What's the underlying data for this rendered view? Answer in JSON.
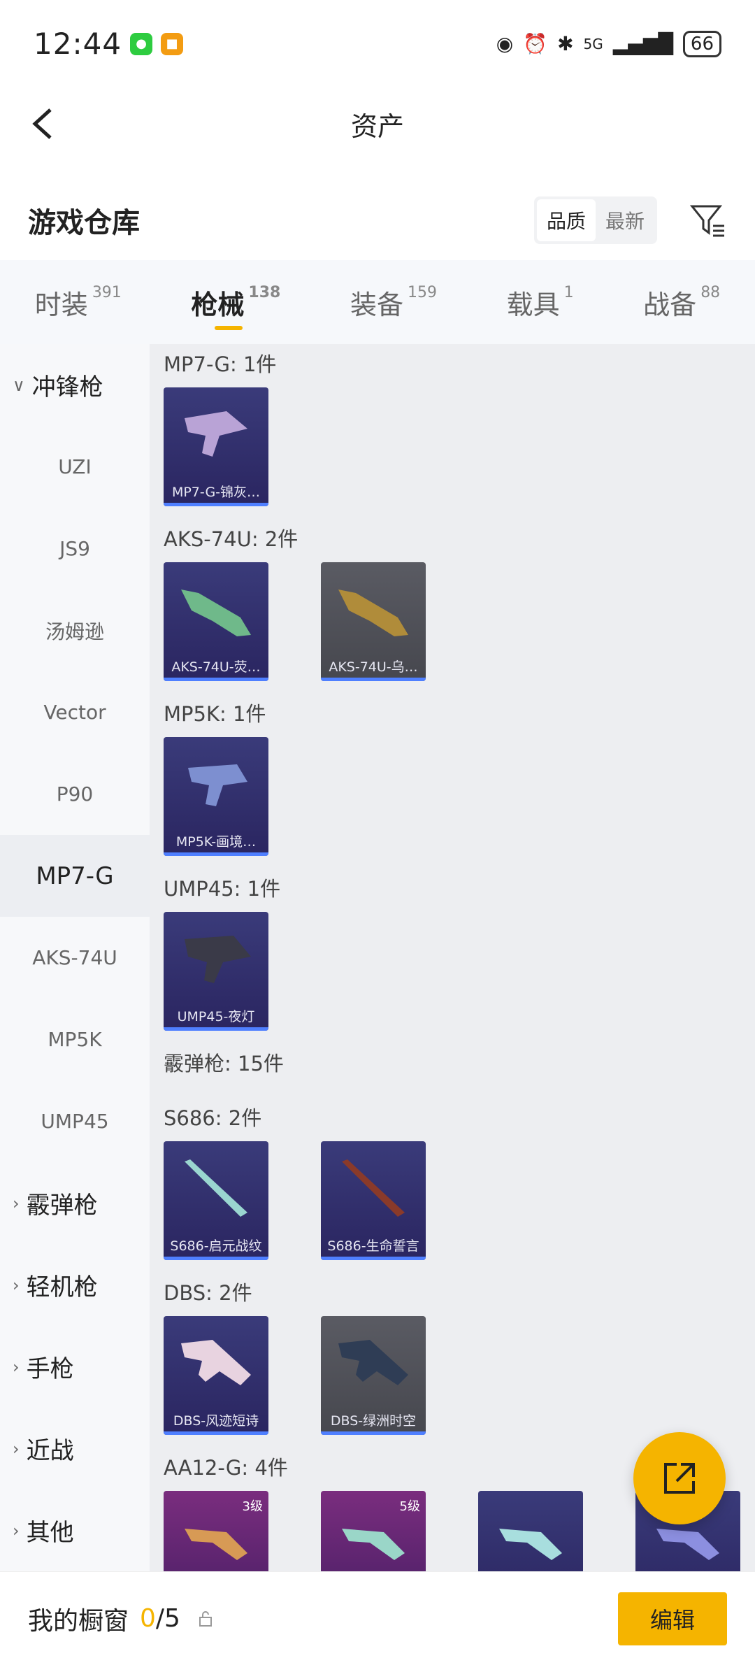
{
  "status": {
    "time": "12:44",
    "battery": "66",
    "network": "5G"
  },
  "header": {
    "title": "资产"
  },
  "warehouse": {
    "title": "游戏仓库",
    "sort_quality": "品质",
    "sort_latest": "最新"
  },
  "tabs": [
    {
      "label": "时装",
      "count": "391"
    },
    {
      "label": "枪械",
      "count": "138"
    },
    {
      "label": "装备",
      "count": "159"
    },
    {
      "label": "载具",
      "count": "1"
    },
    {
      "label": "战备",
      "count": "88"
    }
  ],
  "sidebar": {
    "category_smg": "冲锋枪",
    "subs": [
      "UZI",
      "JS9",
      "汤姆逊",
      "Vector",
      "P90",
      "MP7-G",
      "AKS-74U",
      "MP5K",
      "UMP45"
    ],
    "category_shotgun": "霰弹枪",
    "category_lmg": "轻机枪",
    "category_pistol": "手枪",
    "category_melee": "近战",
    "category_other": "其他"
  },
  "groups": {
    "mp7": {
      "title": "MP7-G: 1件",
      "items": [
        "MP7-G-锦灰…"
      ]
    },
    "aks": {
      "title": "AKS-74U: 2件",
      "items": [
        "AKS-74U-荧…",
        "AKS-74U-乌…"
      ]
    },
    "mp5k": {
      "title": "MP5K: 1件",
      "items": [
        "MP5K-画境…"
      ]
    },
    "ump": {
      "title": "UMP45: 1件",
      "items": [
        "UMP45-夜灯"
      ]
    },
    "shotgun": {
      "title": "霰弹枪: 15件"
    },
    "s686": {
      "title": "S686: 2件",
      "items": [
        "S686-启元战纹",
        "S686-生命誓言"
      ]
    },
    "dbs": {
      "title": "DBS: 2件",
      "items": [
        "DBS-风迹短诗",
        "DBS-绿洲时空"
      ]
    },
    "aa12": {
      "title": "AA12-G: 4件",
      "levels": [
        "3级",
        "5级"
      ]
    }
  },
  "bottom": {
    "label": "我的橱窗",
    "count": "0",
    "total": "/5",
    "edit": "编辑"
  },
  "colors": {
    "accent": "#f5b400",
    "card_purple": "#3a3b7a",
    "card_gray": "#5a5b63"
  }
}
